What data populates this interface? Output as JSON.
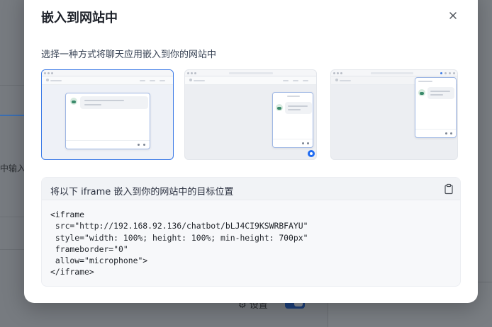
{
  "background": {
    "left_input_fragment": "中输入",
    "settings_label": "设置"
  },
  "modal": {
    "title": "嵌入到网站中",
    "close_icon": "close-icon",
    "subtitle": "选择一种方式将聊天应用嵌入到你的网站中",
    "options": [
      {
        "name": "fullpage-embed",
        "selected": true
      },
      {
        "name": "bubble-embed",
        "selected": false
      },
      {
        "name": "extension-embed",
        "selected": false
      }
    ],
    "code_card": {
      "label": "将以下 iframe 嵌入到你的网站中的目标位置",
      "copy_icon": "clipboard-icon",
      "code": "<iframe\n src=\"http://192.168.92.136/chatbot/bLJ4CI9KSWRBFAYU\"\n style=\"width: 100%; height: 100%; min-height: 700px\"\n frameborder=\"0\"\n allow=\"microphone\">\n</iframe>"
    }
  },
  "colors": {
    "accent": "#3a79e6",
    "bubble_button": "#1f6bf2",
    "overlay": "#74787d"
  }
}
